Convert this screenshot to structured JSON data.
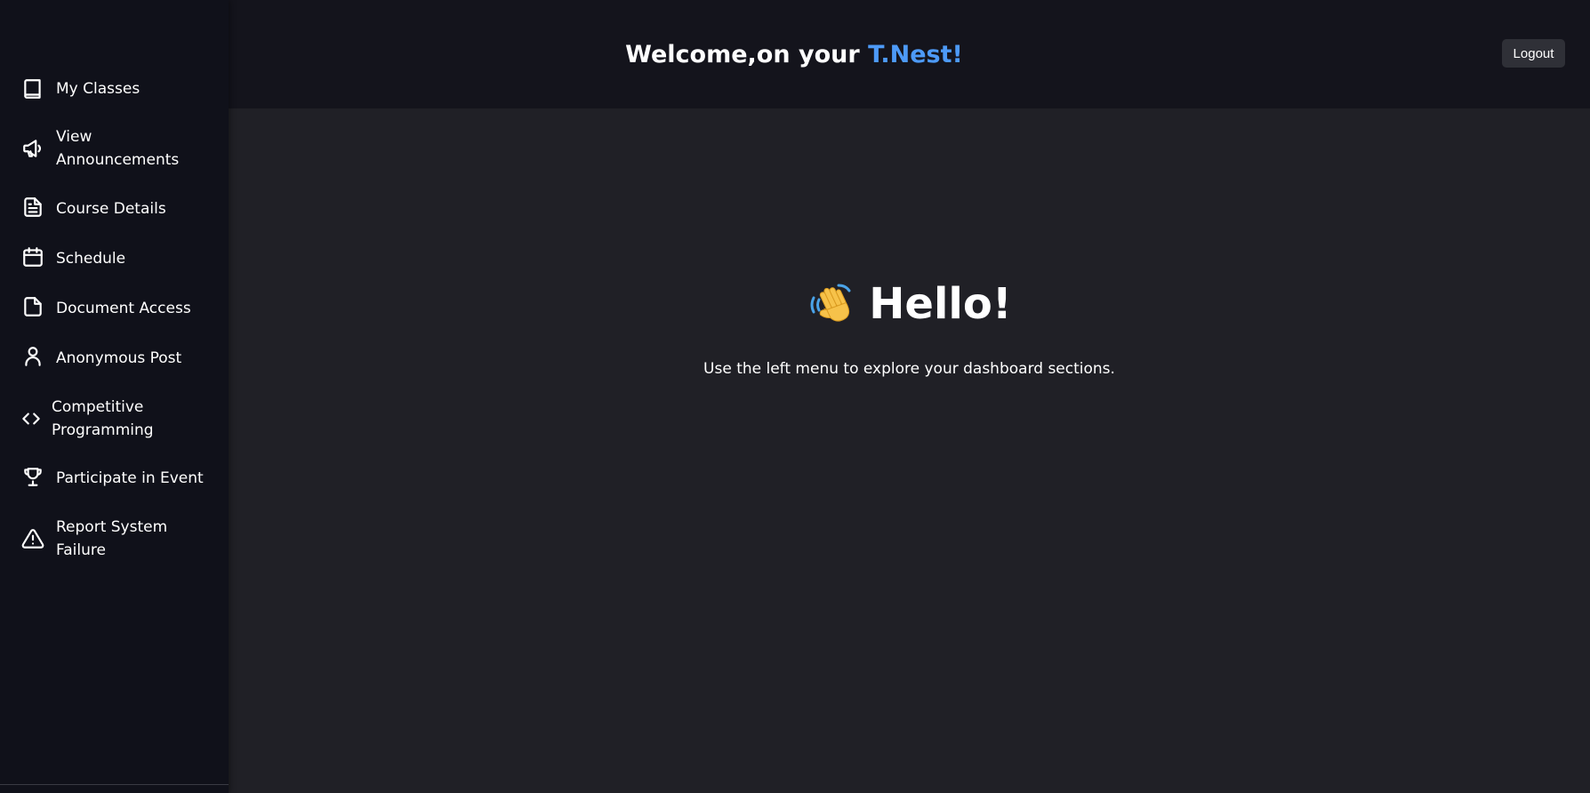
{
  "header": {
    "title_prefix": "Welcome,on your ",
    "title_brand": "T.Nest!",
    "logout_label": "Logout"
  },
  "sidebar": {
    "items": [
      {
        "label": "My Classes",
        "icon": "book-icon"
      },
      {
        "label": "View Announcements",
        "icon": "megaphone-icon"
      },
      {
        "label": "Course Details",
        "icon": "document-text-icon"
      },
      {
        "label": "Schedule",
        "icon": "calendar-icon"
      },
      {
        "label": "Document Access",
        "icon": "file-icon"
      },
      {
        "label": "Anonymous Post",
        "icon": "user-icon"
      },
      {
        "label": "Competitive Programming",
        "icon": "code-icon"
      },
      {
        "label": "Participate in Event",
        "icon": "trophy-icon"
      },
      {
        "label": "Report System Failure",
        "icon": "warning-icon"
      }
    ]
  },
  "main": {
    "greeting": "Hello!",
    "greeting_icon": "waving-hand-icon",
    "subtext": "Use the left menu to explore your dashboard sections."
  },
  "colors": {
    "brand": "#4d9af7",
    "sidebar_bg": "#10111a",
    "header_bg": "#14141c",
    "main_bg": "#202026"
  }
}
